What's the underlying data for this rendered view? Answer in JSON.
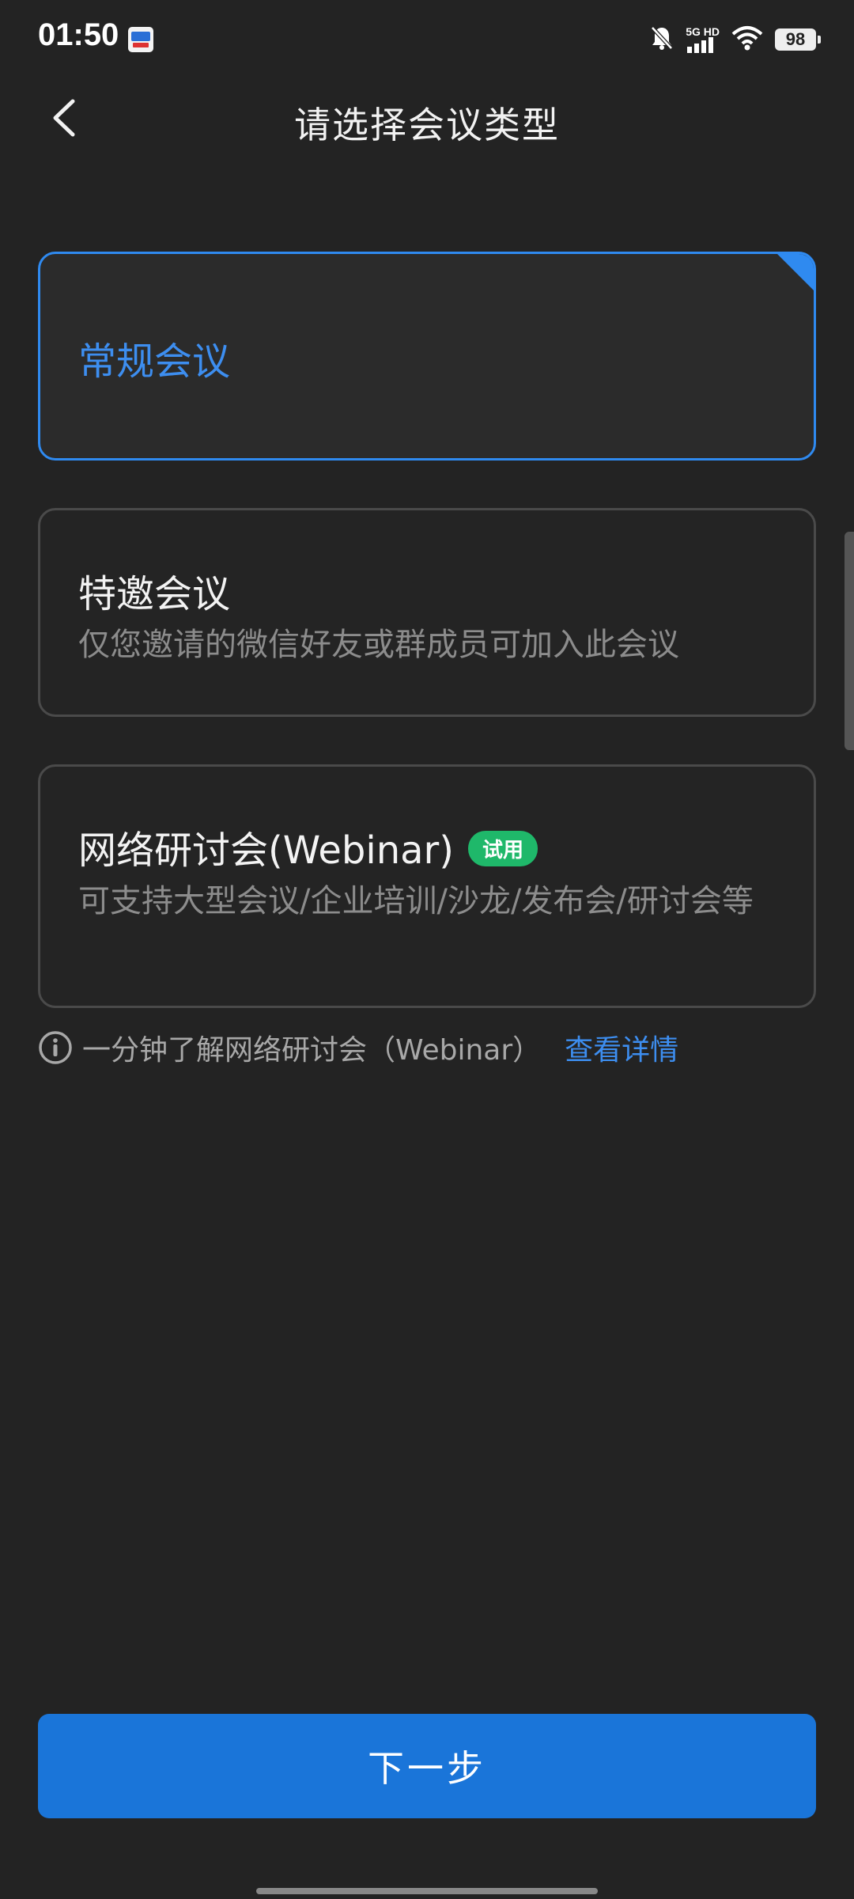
{
  "status_bar": {
    "time": "01:50",
    "network_top": "5G HD",
    "battery": "98",
    "icons": [
      "app-notification-icon",
      "mute-bell-icon",
      "signal-icon",
      "wifi-icon",
      "battery-icon"
    ]
  },
  "header": {
    "title": "请选择会议类型",
    "back_icon": "chevron-left-icon"
  },
  "options": [
    {
      "title": "常规会议",
      "description": "",
      "selected": true
    },
    {
      "title": "特邀会议",
      "description": "仅您邀请的微信好友或群成员可加入此会议",
      "selected": false
    },
    {
      "title": "网络研讨会(Webinar)",
      "badge": "试用",
      "description": "可支持大型会议/企业培训/沙龙/发布会/研讨会等",
      "selected": false
    }
  ],
  "info": {
    "text": "一分钟了解网络研讨会（Webinar）",
    "link": "查看详情",
    "icon": "info-icon"
  },
  "footer": {
    "next_label": "下一步"
  },
  "colors": {
    "background": "#232323",
    "accent": "#2f8af0",
    "button": "#1a75d9",
    "badge": "#1fb86a"
  }
}
